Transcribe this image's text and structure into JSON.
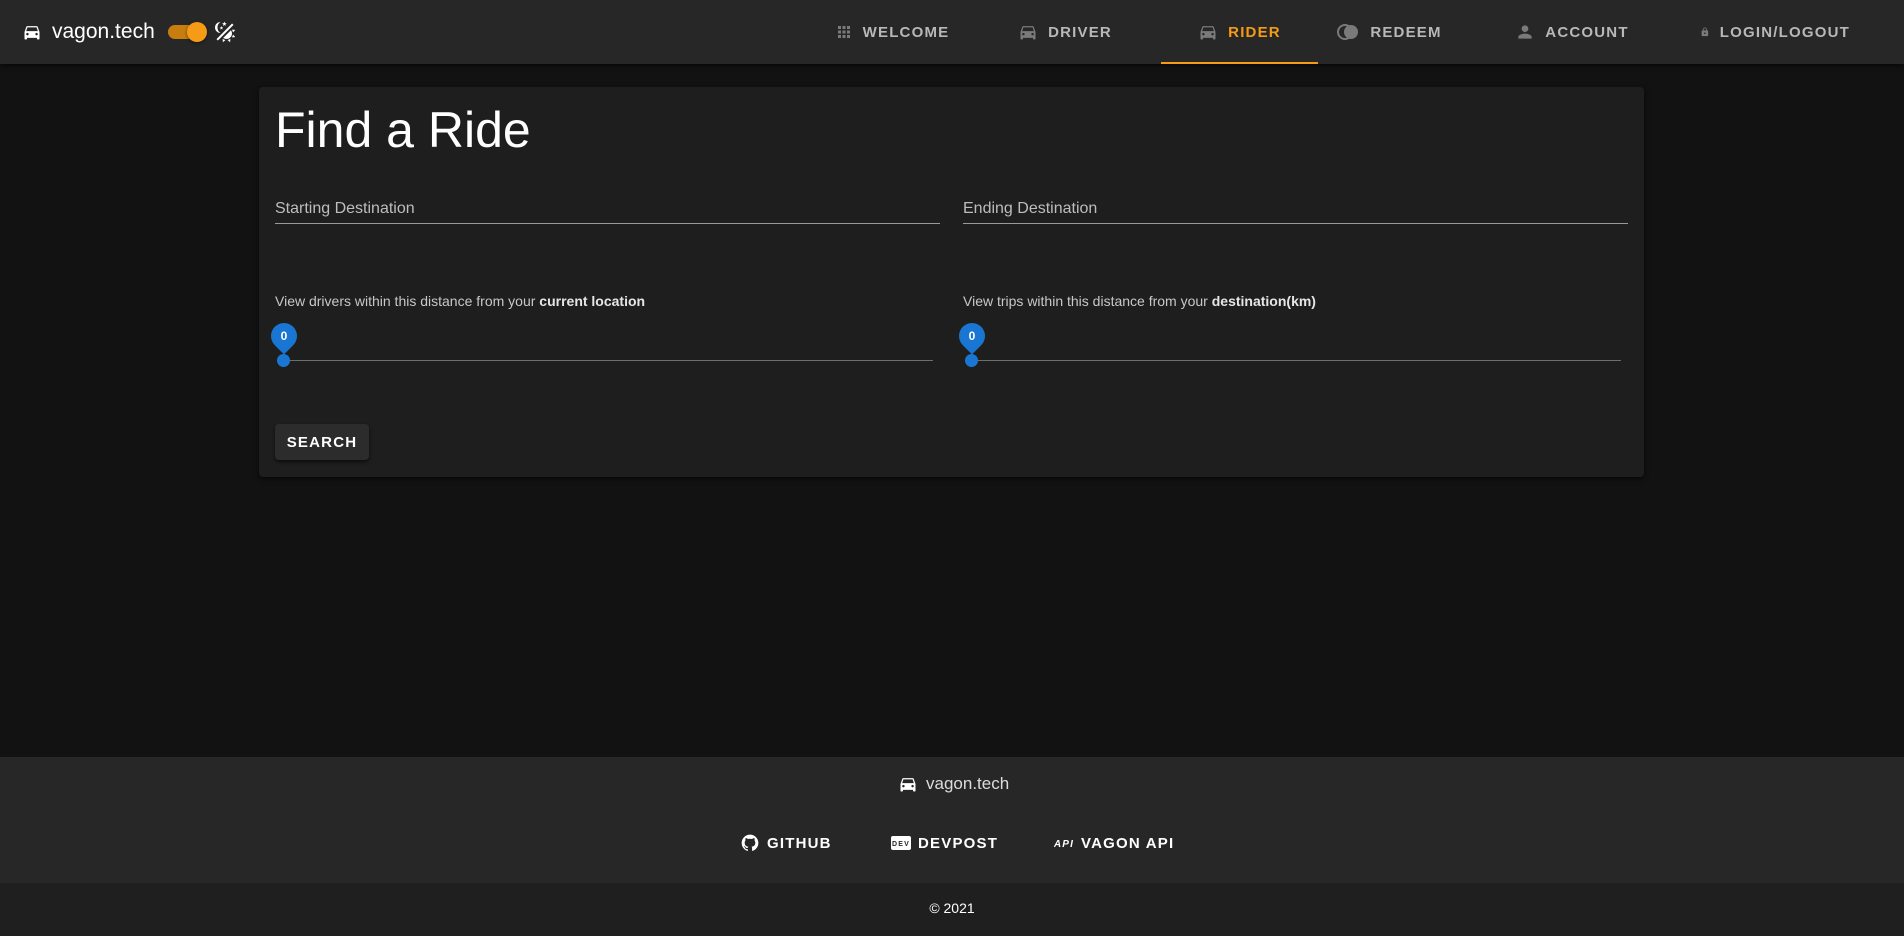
{
  "header": {
    "brand": "vagon.tech",
    "theme_toggle_on": true,
    "nav": [
      {
        "label": "WELCOME",
        "icon": "apps-grid-icon"
      },
      {
        "label": "DRIVER",
        "icon": "car-icon"
      },
      {
        "label": "RIDER",
        "icon": "car-icon",
        "active": true
      },
      {
        "label": "REDEEM",
        "icon": "coins-icon"
      },
      {
        "label": "ACCOUNT",
        "icon": "person-icon"
      },
      {
        "label": "LOGIN/LOGOUT",
        "icon": "lock-icon"
      }
    ]
  },
  "main": {
    "title": "Find a Ride",
    "start_placeholder": "Starting Destination",
    "end_placeholder": "Ending Destination",
    "slider1": {
      "label_prefix": "View drivers within this distance from your ",
      "label_bold": "current location",
      "value": "0"
    },
    "slider2": {
      "label_prefix": "View trips within this distance from your ",
      "label_bold": "destination(km)",
      "value": "0"
    },
    "search_label": "SEARCH"
  },
  "footer": {
    "brand": "vagon.tech",
    "links": [
      {
        "label": "GITHUB",
        "icon": "github-icon"
      },
      {
        "label": "DEVPOST",
        "icon": "dev-icon"
      },
      {
        "label": "VAGON API",
        "icon": "api-icon"
      }
    ],
    "copyright": "© 2021"
  },
  "colors": {
    "accent": "#f59b15",
    "slider": "#1976d2",
    "background": "#121212",
    "surface": "#1e1e1e",
    "bar": "#272727"
  }
}
